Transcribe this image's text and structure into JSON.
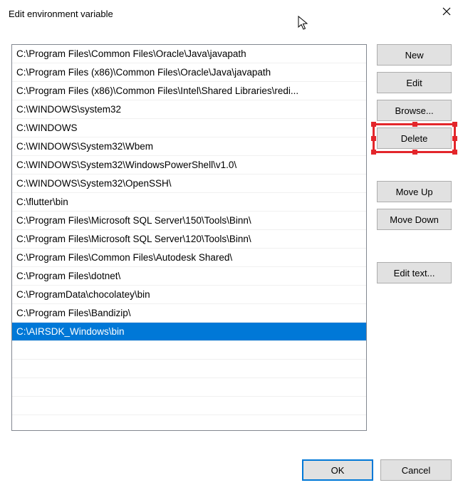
{
  "window": {
    "title": "Edit environment variable"
  },
  "list": {
    "items": [
      "C:\\Program Files\\Common Files\\Oracle\\Java\\javapath",
      "C:\\Program Files (x86)\\Common Files\\Oracle\\Java\\javapath",
      "C:\\Program Files (x86)\\Common Files\\Intel\\Shared Libraries\\redi...",
      "C:\\WINDOWS\\system32",
      "C:\\WINDOWS",
      "C:\\WINDOWS\\System32\\Wbem",
      "C:\\WINDOWS\\System32\\WindowsPowerShell\\v1.0\\",
      "C:\\WINDOWS\\System32\\OpenSSH\\",
      "C:\\flutter\\bin",
      "C:\\Program Files\\Microsoft SQL Server\\150\\Tools\\Binn\\",
      "C:\\Program Files\\Microsoft SQL Server\\120\\Tools\\Binn\\",
      "C:\\Program Files\\Common Files\\Autodesk Shared\\",
      "C:\\Program Files\\dotnet\\",
      "C:\\ProgramData\\chocolatey\\bin",
      "C:\\Program Files\\Bandizip\\",
      "C:\\AIRSDK_Windows\\bin"
    ],
    "selected_index": 15
  },
  "buttons": {
    "new": "New",
    "edit": "Edit",
    "browse": "Browse...",
    "delete": "Delete",
    "move_up": "Move Up",
    "move_down": "Move Down",
    "edit_text": "Edit text...",
    "ok": "OK",
    "cancel": "Cancel"
  }
}
